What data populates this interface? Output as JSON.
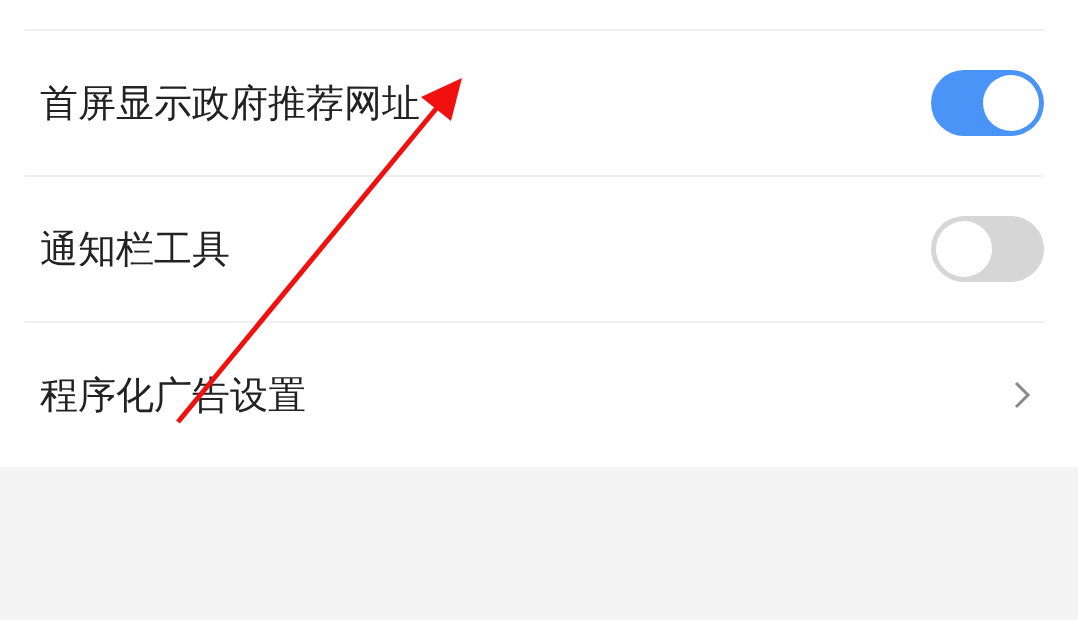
{
  "settings": [
    {
      "kind": "toggle",
      "label": "首屏显示政府推荐网址",
      "on": true
    },
    {
      "kind": "toggle",
      "label": "通知栏工具",
      "on": false
    },
    {
      "kind": "link",
      "label": "程序化广告设置"
    }
  ]
}
